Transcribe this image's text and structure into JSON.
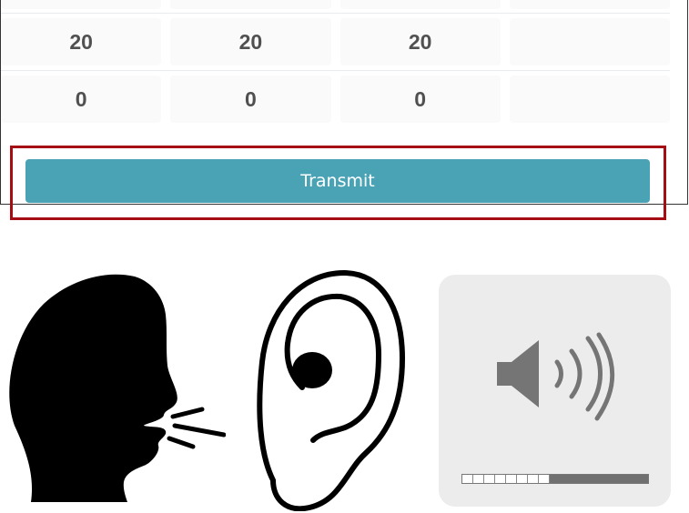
{
  "table": {
    "rows": [
      [
        "20",
        "20",
        "20",
        ""
      ],
      [
        "0",
        "0",
        "0",
        ""
      ]
    ]
  },
  "transmit_button": {
    "label": "Transmit",
    "color": "#4aa3b5"
  },
  "highlight": {
    "color": "#a50d14"
  },
  "icons": {
    "speaker_person": "speaking-head-icon",
    "ear": "ear-icon",
    "speaker": "speaker-volume-icon"
  },
  "volume": {
    "level": 0.5
  }
}
